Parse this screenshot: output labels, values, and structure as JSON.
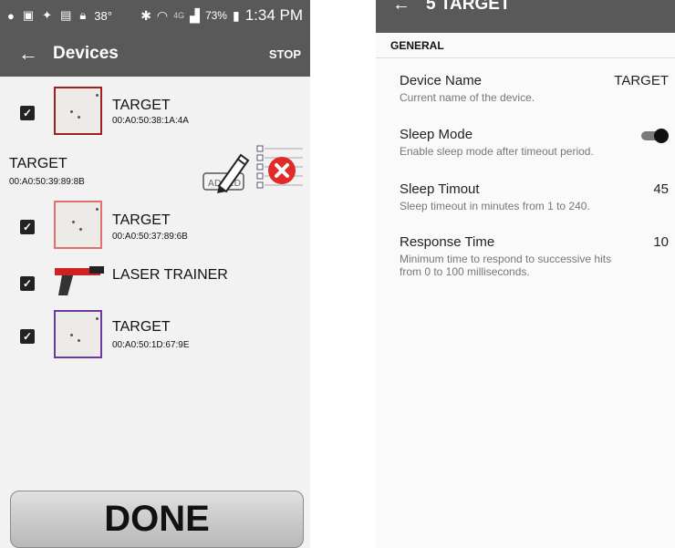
{
  "left": {
    "status": {
      "icons": [
        "chat-icon",
        "image-icon",
        "dropbox-icon",
        "gallery-icon",
        "lock-icon"
      ],
      "temperature": "38°",
      "network": "4G",
      "battery": "73%",
      "time": "1:34 PM"
    },
    "appbar": {
      "title": "Devices",
      "stop_label": "STOP"
    },
    "devices": [
      {
        "name": "TARGET",
        "mac": "00:A0:50:38:1A:4A",
        "checked": true,
        "border": "#a02020"
      },
      {
        "name": "TARGET",
        "mac": "00:A0:50:39:89:8B"
      },
      {
        "name": "TARGET",
        "mac": "00:A0:50:37:89:6B",
        "checked": true,
        "border": "#e07070"
      },
      {
        "name": "LASER TRAINER",
        "checked": true
      },
      {
        "name": "TARGET",
        "mac": "00:A0:50:1D:67:9E",
        "checked": true,
        "border": "#6a3aa0"
      }
    ],
    "row_actions": {
      "edit_icon": "pencil-add-icon",
      "delete_icon": "red-x-icon",
      "list_icon": "checklist-icon",
      "add_stamp": "ADDED"
    },
    "done_label": "DONE"
  },
  "right": {
    "title": "5 TARGET",
    "section": "GENERAL",
    "prefs": [
      {
        "title": "Device Name",
        "summary": "Current name of the device.",
        "value": "TARGET"
      },
      {
        "title": "Sleep Mode",
        "summary": "Enable sleep mode after timeout period.",
        "toggle": true
      },
      {
        "title": "Sleep Timout",
        "summary": "Sleep timeout in minutes from 1 to 240.",
        "value": "45"
      },
      {
        "title": "Response Time",
        "summary": "Minimum time to respond to successive hits from 0 to 100 milliseconds.",
        "value": "10"
      }
    ]
  }
}
